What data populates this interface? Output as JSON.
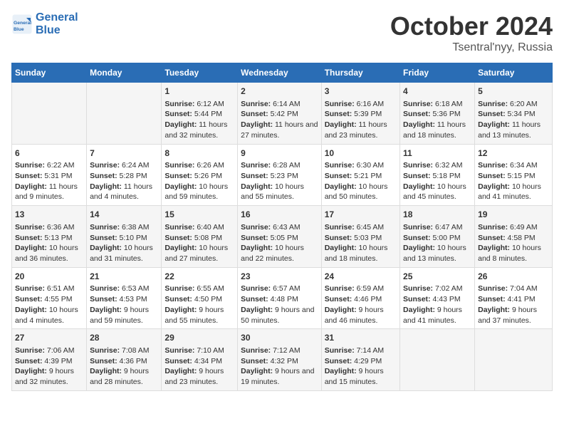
{
  "logo": {
    "line1": "General",
    "line2": "Blue"
  },
  "title": "October 2024",
  "subtitle": "Tsentral'nyy, Russia",
  "days_of_week": [
    "Sunday",
    "Monday",
    "Tuesday",
    "Wednesday",
    "Thursday",
    "Friday",
    "Saturday"
  ],
  "rows": [
    [
      {
        "day": "",
        "sunrise": "",
        "sunset": "",
        "daylight": ""
      },
      {
        "day": "",
        "sunrise": "",
        "sunset": "",
        "daylight": ""
      },
      {
        "day": "1",
        "sunrise": "6:12 AM",
        "sunset": "5:44 PM",
        "daylight": "11 hours and 32 minutes."
      },
      {
        "day": "2",
        "sunrise": "6:14 AM",
        "sunset": "5:42 PM",
        "daylight": "11 hours and 27 minutes."
      },
      {
        "day": "3",
        "sunrise": "6:16 AM",
        "sunset": "5:39 PM",
        "daylight": "11 hours and 23 minutes."
      },
      {
        "day": "4",
        "sunrise": "6:18 AM",
        "sunset": "5:36 PM",
        "daylight": "11 hours and 18 minutes."
      },
      {
        "day": "5",
        "sunrise": "6:20 AM",
        "sunset": "5:34 PM",
        "daylight": "11 hours and 13 minutes."
      }
    ],
    [
      {
        "day": "6",
        "sunrise": "6:22 AM",
        "sunset": "5:31 PM",
        "daylight": "11 hours and 9 minutes."
      },
      {
        "day": "7",
        "sunrise": "6:24 AM",
        "sunset": "5:28 PM",
        "daylight": "11 hours and 4 minutes."
      },
      {
        "day": "8",
        "sunrise": "6:26 AM",
        "sunset": "5:26 PM",
        "daylight": "10 hours and 59 minutes."
      },
      {
        "day": "9",
        "sunrise": "6:28 AM",
        "sunset": "5:23 PM",
        "daylight": "10 hours and 55 minutes."
      },
      {
        "day": "10",
        "sunrise": "6:30 AM",
        "sunset": "5:21 PM",
        "daylight": "10 hours and 50 minutes."
      },
      {
        "day": "11",
        "sunrise": "6:32 AM",
        "sunset": "5:18 PM",
        "daylight": "10 hours and 45 minutes."
      },
      {
        "day": "12",
        "sunrise": "6:34 AM",
        "sunset": "5:15 PM",
        "daylight": "10 hours and 41 minutes."
      }
    ],
    [
      {
        "day": "13",
        "sunrise": "6:36 AM",
        "sunset": "5:13 PM",
        "daylight": "10 hours and 36 minutes."
      },
      {
        "day": "14",
        "sunrise": "6:38 AM",
        "sunset": "5:10 PM",
        "daylight": "10 hours and 31 minutes."
      },
      {
        "day": "15",
        "sunrise": "6:40 AM",
        "sunset": "5:08 PM",
        "daylight": "10 hours and 27 minutes."
      },
      {
        "day": "16",
        "sunrise": "6:43 AM",
        "sunset": "5:05 PM",
        "daylight": "10 hours and 22 minutes."
      },
      {
        "day": "17",
        "sunrise": "6:45 AM",
        "sunset": "5:03 PM",
        "daylight": "10 hours and 18 minutes."
      },
      {
        "day": "18",
        "sunrise": "6:47 AM",
        "sunset": "5:00 PM",
        "daylight": "10 hours and 13 minutes."
      },
      {
        "day": "19",
        "sunrise": "6:49 AM",
        "sunset": "4:58 PM",
        "daylight": "10 hours and 8 minutes."
      }
    ],
    [
      {
        "day": "20",
        "sunrise": "6:51 AM",
        "sunset": "4:55 PM",
        "daylight": "10 hours and 4 minutes."
      },
      {
        "day": "21",
        "sunrise": "6:53 AM",
        "sunset": "4:53 PM",
        "daylight": "9 hours and 59 minutes."
      },
      {
        "day": "22",
        "sunrise": "6:55 AM",
        "sunset": "4:50 PM",
        "daylight": "9 hours and 55 minutes."
      },
      {
        "day": "23",
        "sunrise": "6:57 AM",
        "sunset": "4:48 PM",
        "daylight": "9 hours and 50 minutes."
      },
      {
        "day": "24",
        "sunrise": "6:59 AM",
        "sunset": "4:46 PM",
        "daylight": "9 hours and 46 minutes."
      },
      {
        "day": "25",
        "sunrise": "7:02 AM",
        "sunset": "4:43 PM",
        "daylight": "9 hours and 41 minutes."
      },
      {
        "day": "26",
        "sunrise": "7:04 AM",
        "sunset": "4:41 PM",
        "daylight": "9 hours and 37 minutes."
      }
    ],
    [
      {
        "day": "27",
        "sunrise": "7:06 AM",
        "sunset": "4:39 PM",
        "daylight": "9 hours and 32 minutes."
      },
      {
        "day": "28",
        "sunrise": "7:08 AM",
        "sunset": "4:36 PM",
        "daylight": "9 hours and 28 minutes."
      },
      {
        "day": "29",
        "sunrise": "7:10 AM",
        "sunset": "4:34 PM",
        "daylight": "9 hours and 23 minutes."
      },
      {
        "day": "30",
        "sunrise": "7:12 AM",
        "sunset": "4:32 PM",
        "daylight": "9 hours and 19 minutes."
      },
      {
        "day": "31",
        "sunrise": "7:14 AM",
        "sunset": "4:29 PM",
        "daylight": "9 hours and 15 minutes."
      },
      {
        "day": "",
        "sunrise": "",
        "sunset": "",
        "daylight": ""
      },
      {
        "day": "",
        "sunrise": "",
        "sunset": "",
        "daylight": ""
      }
    ]
  ],
  "labels": {
    "sunrise": "Sunrise:",
    "sunset": "Sunset:",
    "daylight": "Daylight:"
  }
}
